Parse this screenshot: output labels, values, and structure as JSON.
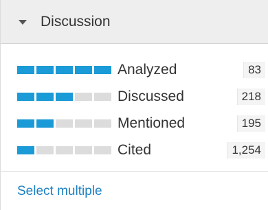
{
  "panel": {
    "title": "Discussion",
    "caret_icon": "caret-down-icon"
  },
  "rows": [
    {
      "label": "Analyzed",
      "count": "83",
      "level": 5,
      "max_level": 5
    },
    {
      "label": "Discussed",
      "count": "218",
      "level": 3,
      "max_level": 5
    },
    {
      "label": "Mentioned",
      "count": "195",
      "level": 2,
      "max_level": 5
    },
    {
      "label": "Cited",
      "count": "1,254",
      "level": 1,
      "max_level": 5
    }
  ],
  "footer": {
    "select_multiple_label": "Select multiple"
  },
  "colors": {
    "bar_filled": "#1a9ad6",
    "bar_empty": "#dcdcdc",
    "link": "#1a7fc1"
  }
}
